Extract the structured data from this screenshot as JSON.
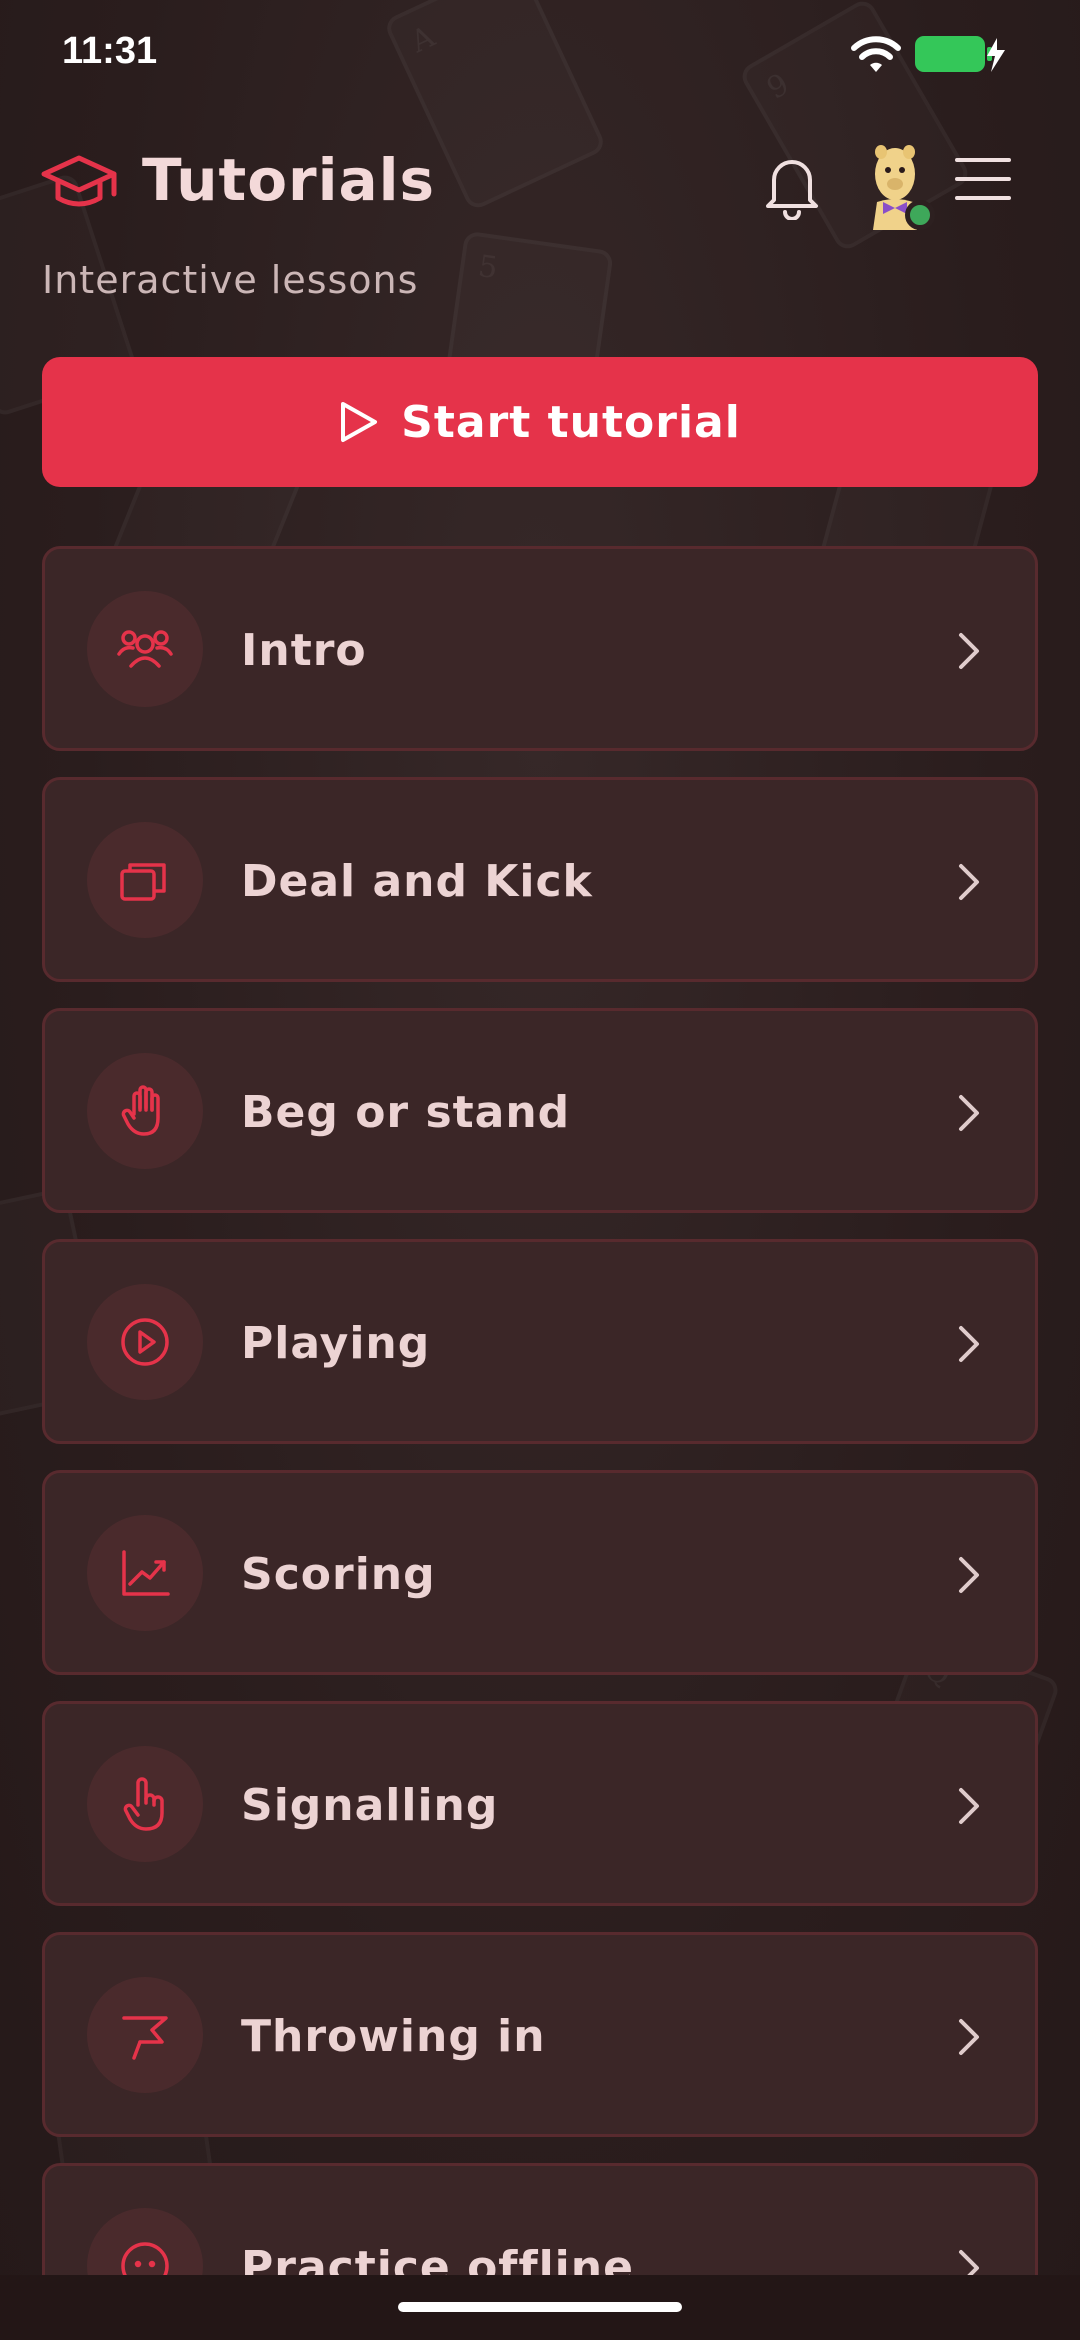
{
  "status_bar": {
    "time": "11:31"
  },
  "header": {
    "title": "Tutorials",
    "subtitle": "Interactive lessons"
  },
  "start_button": {
    "label": "Start tutorial"
  },
  "lessons": [
    {
      "label": "Intro",
      "icon": "users-icon"
    },
    {
      "label": "Deal and Kick",
      "icon": "cards-icon"
    },
    {
      "label": "Beg or stand",
      "icon": "hand-icon"
    },
    {
      "label": "Playing",
      "icon": "play-circle-icon"
    },
    {
      "label": "Scoring",
      "icon": "chart-icon"
    },
    {
      "label": "Signalling",
      "icon": "pointer-hand-icon"
    },
    {
      "label": "Throwing in",
      "icon": "flag-icon"
    },
    {
      "label": "Practice offline",
      "icon": "bot-icon"
    }
  ],
  "colors": {
    "accent": "#e5334a",
    "background": "#2d2020",
    "card": "#3b2627",
    "online": "#3ea85a"
  }
}
